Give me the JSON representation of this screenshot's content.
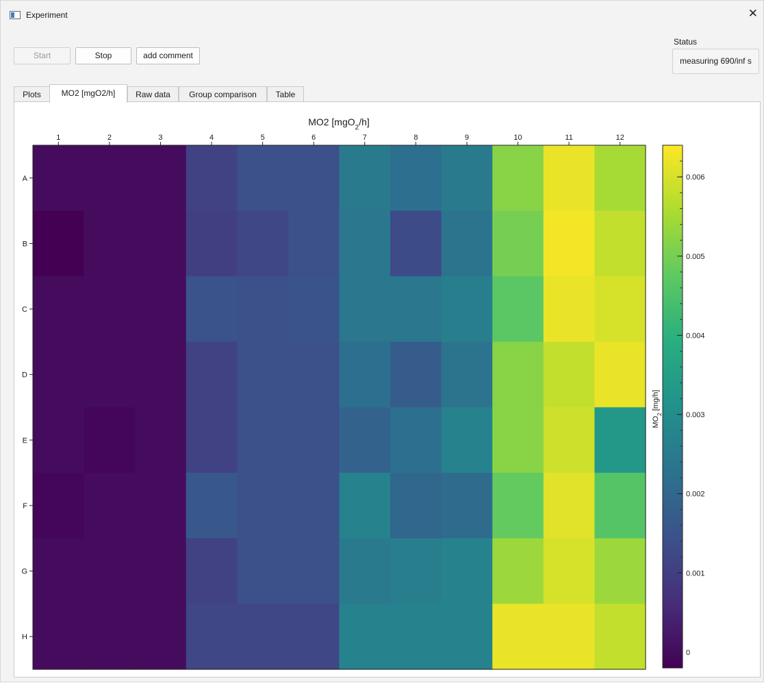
{
  "window": {
    "title": "Experiment",
    "close_icon": "close-icon"
  },
  "toolbar": {
    "start_label": "Start",
    "stop_label": "Stop",
    "comment_label": "add comment"
  },
  "status": {
    "label": "Status",
    "value": "measuring 690/inf s"
  },
  "tabs": [
    {
      "label": "Plots",
      "active": false
    },
    {
      "label": "MO2 [mgO2/h]",
      "active": true
    },
    {
      "label": "Raw data",
      "active": false
    },
    {
      "label": "Group comparison",
      "active": false
    },
    {
      "label": "Table",
      "active": false
    }
  ],
  "chart_data": {
    "type": "heatmap",
    "title_parts": [
      "MO2 [mgO",
      "2",
      "/h]"
    ],
    "colorbar_label_parts": [
      "MO",
      "2",
      " [mg/h]"
    ],
    "columns": [
      "1",
      "2",
      "3",
      "4",
      "5",
      "6",
      "7",
      "8",
      "9",
      "10",
      "11",
      "12"
    ],
    "rows": [
      "A",
      "B",
      "C",
      "D",
      "E",
      "F",
      "G",
      "H"
    ],
    "colormap": "viridis",
    "colorbar_range": [
      -0.0002,
      0.0064
    ],
    "colorbar_ticks": [
      0,
      0.001,
      0.002,
      0.003,
      0.004,
      0.005,
      0.006
    ],
    "colorbar_tick_labels": [
      "0",
      "0.001",
      "0.002",
      "0.003",
      "0.004",
      "0.005",
      "0.006"
    ],
    "values": [
      [
        0.0,
        0.0,
        0.0,
        0.0011,
        0.0014,
        0.0014,
        0.0025,
        0.0022,
        0.0025,
        0.0052,
        0.0062,
        0.0055
      ],
      [
        -0.0002,
        0.0,
        0.0,
        0.001,
        0.0012,
        0.0014,
        0.0024,
        0.0013,
        0.0023,
        0.005,
        0.0063,
        0.0058
      ],
      [
        0.0,
        0.0,
        0.0,
        0.0015,
        0.0014,
        0.0015,
        0.0024,
        0.0024,
        0.0026,
        0.0047,
        0.0062,
        0.006
      ],
      [
        0.0,
        0.0,
        0.0,
        0.0011,
        0.0014,
        0.0014,
        0.0022,
        0.0017,
        0.0023,
        0.0052,
        0.0058,
        0.0062
      ],
      [
        0.0,
        -0.0001,
        0.0,
        0.0011,
        0.0014,
        0.0014,
        0.0019,
        0.0022,
        0.0027,
        0.0052,
        0.0059,
        0.0033
      ],
      [
        -0.0001,
        0.0,
        0.0,
        0.0016,
        0.0014,
        0.0014,
        0.0027,
        0.002,
        0.0021,
        0.0048,
        0.0061,
        0.0046
      ],
      [
        0.0,
        0.0,
        0.0,
        0.0011,
        0.0014,
        0.0014,
        0.0025,
        0.0026,
        0.0027,
        0.0054,
        0.006,
        0.0054
      ],
      [
        0.0,
        0.0,
        0.0,
        0.0012,
        0.0012,
        0.0012,
        0.0027,
        0.0027,
        0.0027,
        0.0062,
        0.0062,
        0.0058
      ]
    ]
  }
}
